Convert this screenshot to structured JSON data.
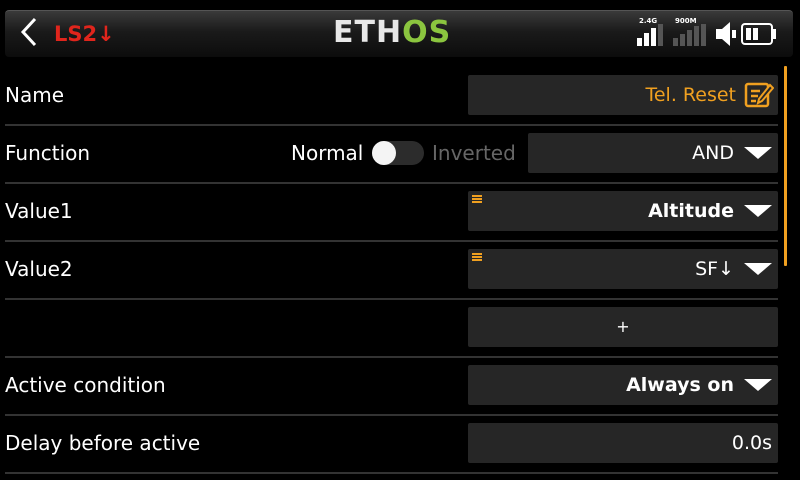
{
  "header": {
    "title": "LS2↓",
    "logo_part1": "ETH",
    "logo_part2": "OS",
    "rf_label_1": "2.4G",
    "rf_label_2": "900M"
  },
  "rows": {
    "name": {
      "label": "Name",
      "value": "Tel. Reset"
    },
    "function": {
      "label": "Function",
      "option_off": "Normal",
      "option_on": "Inverted",
      "toggle_state": "Normal",
      "value": "AND"
    },
    "value1": {
      "label": "Value1",
      "value": "Altitude"
    },
    "value2": {
      "label": "Value2",
      "value": "SF↓"
    },
    "add": {
      "label": "",
      "button": "+"
    },
    "active_condition": {
      "label": "Active condition",
      "value": "Always on"
    },
    "delay": {
      "label": "Delay before active",
      "value": "0.0s"
    }
  },
  "colors": {
    "accent": "#f0a020",
    "title_red": "#e0251c",
    "logo_green": "#8bc53f",
    "field_bg": "#262626"
  },
  "icons": [
    "back-arrow-icon",
    "signal-2-4g-icon",
    "signal-900m-icon",
    "speaker-icon",
    "battery-icon",
    "edit-icon",
    "source-list-icon",
    "dropdown-arrow-icon"
  ]
}
